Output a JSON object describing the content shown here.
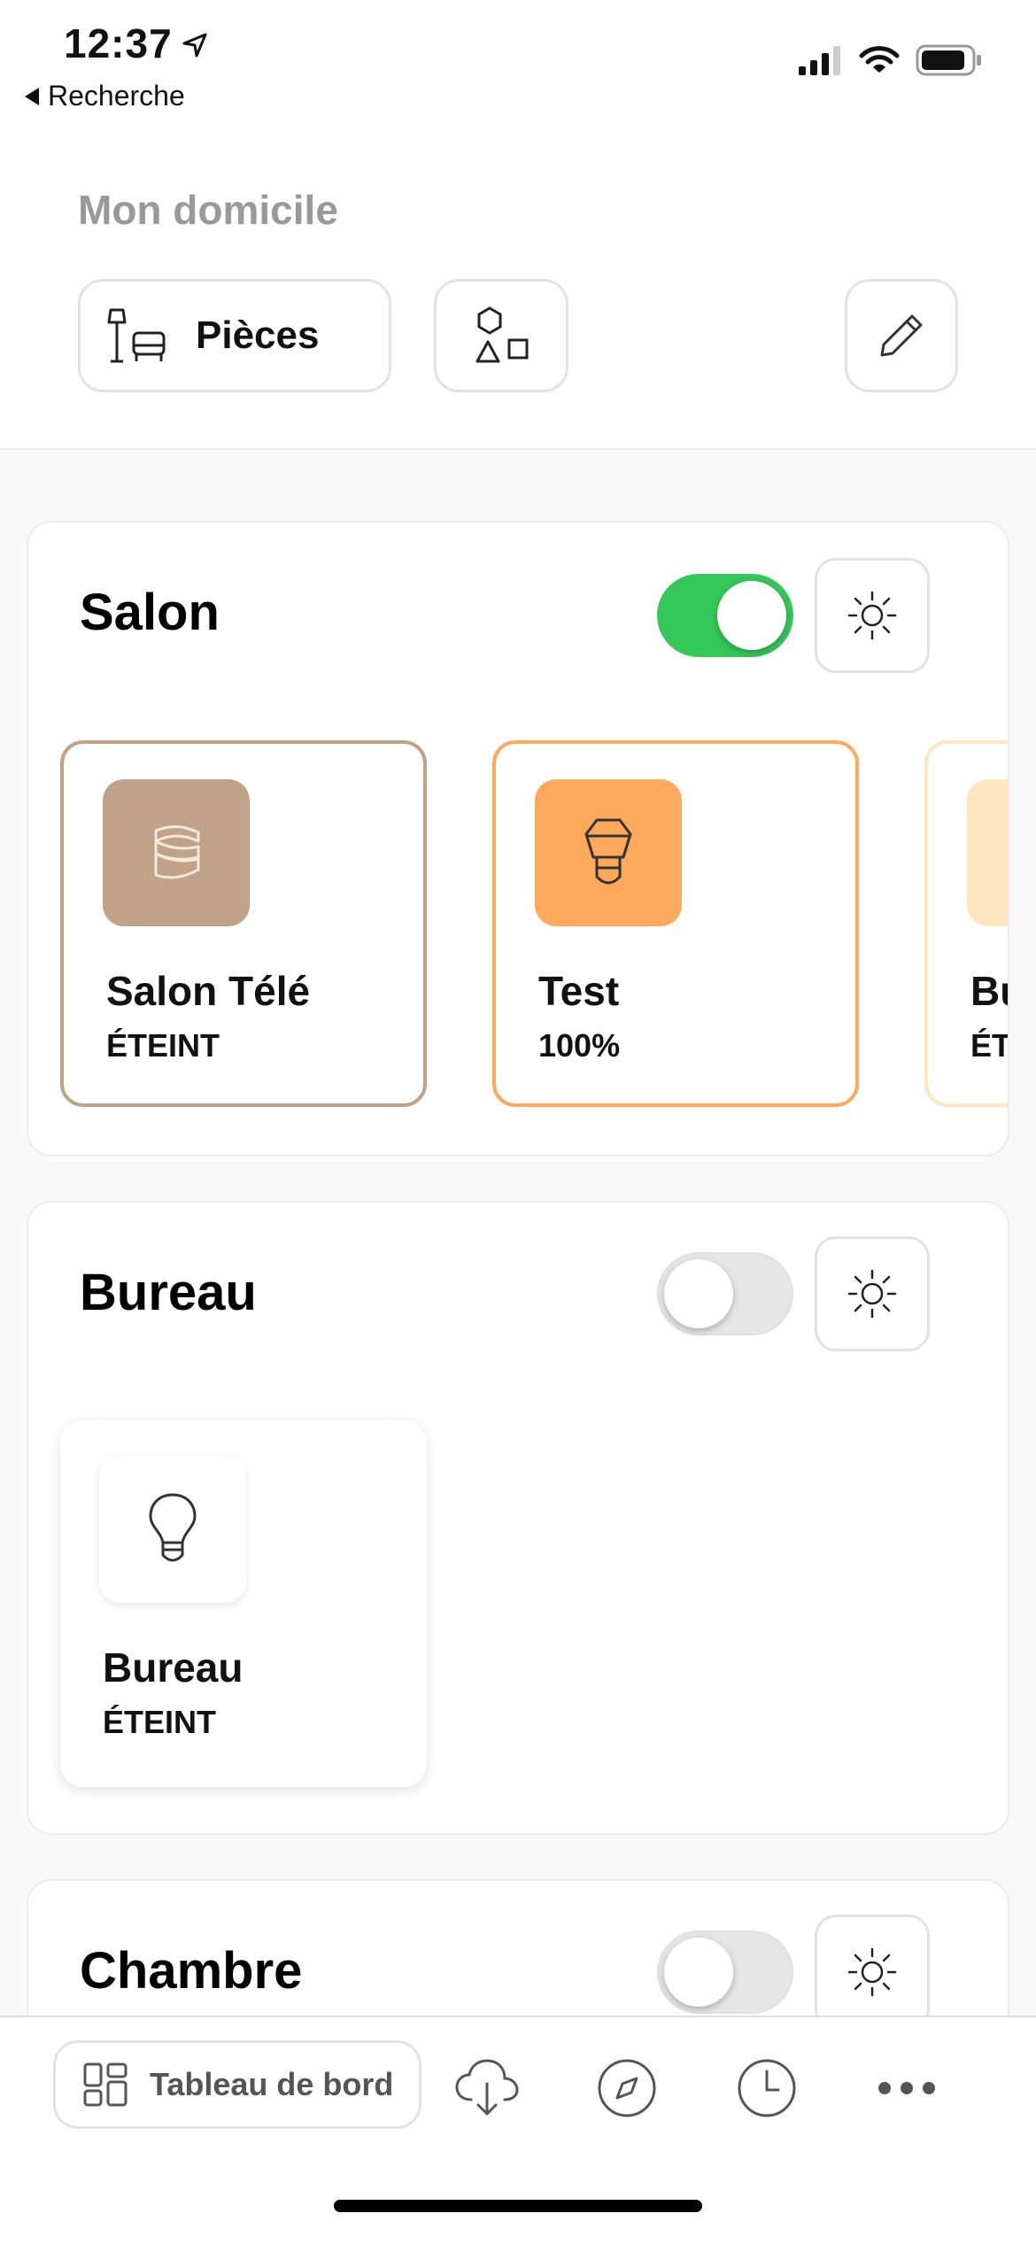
{
  "status_bar": {
    "time": "12:37",
    "back_label": "Recherche",
    "icons": [
      "location-arrow-icon",
      "cellular-signal-icon",
      "wifi-icon",
      "battery-icon"
    ]
  },
  "header": {
    "title": "Mon domicile",
    "rooms_button_label": "Pièces",
    "icons": [
      "lamp-sofa-icon",
      "shapes-icon",
      "pencil-icon"
    ]
  },
  "rooms": [
    {
      "name": "Salon",
      "power_on": true,
      "devices": [
        {
          "name": "Salon Télé",
          "state": "ÉTEINT",
          "icon": "light-strip-icon",
          "color": "#bfa287"
        },
        {
          "name": "Test",
          "state": "100%",
          "icon": "bulb-icon",
          "color": "#ffa95c"
        },
        {
          "name": "Bu",
          "state": "ÉTI",
          "icon": "bulb-icon",
          "color": "#fde6c0"
        }
      ]
    },
    {
      "name": "Bureau",
      "power_on": false,
      "devices": [
        {
          "name": "Bureau",
          "state": "ÉTEINT",
          "icon": "bulb-icon",
          "color": "#ffffff"
        }
      ]
    },
    {
      "name": "Chambre",
      "power_on": false,
      "devices": []
    }
  ],
  "tab_bar": {
    "dashboard_label": "Tableau de bord",
    "icons": [
      "dashboard-grid-icon",
      "cloud-download-icon",
      "compass-icon",
      "clock-icon",
      "more-dots-icon"
    ]
  },
  "colors": {
    "toggle_on": "#35c759",
    "salon_tele": "#bfa287",
    "test": "#ffa95c"
  }
}
